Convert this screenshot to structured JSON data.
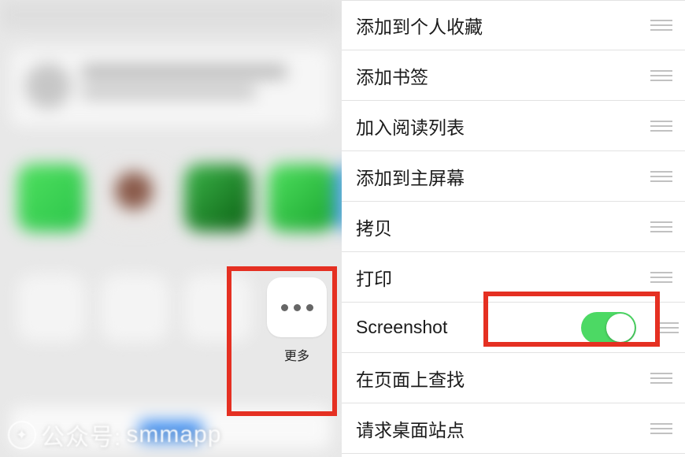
{
  "left": {
    "more_button": {
      "label": "更多"
    },
    "watermark": {
      "prefix": "公众号:",
      "name": "smmapp"
    }
  },
  "right": {
    "items": [
      {
        "label": "添加到个人收藏",
        "interactable": true,
        "has_toggle": false
      },
      {
        "label": "添加书签",
        "interactable": true,
        "has_toggle": false
      },
      {
        "label": "加入阅读列表",
        "interactable": true,
        "has_toggle": false
      },
      {
        "label": "添加到主屏幕",
        "interactable": true,
        "has_toggle": false
      },
      {
        "label": "拷贝",
        "interactable": true,
        "has_toggle": false
      },
      {
        "label": "打印",
        "interactable": true,
        "has_toggle": false
      },
      {
        "label": "Screenshot",
        "interactable": true,
        "has_toggle": true,
        "toggle_on": true
      },
      {
        "label": "在页面上查找",
        "interactable": true,
        "has_toggle": false
      },
      {
        "label": "请求桌面站点",
        "interactable": true,
        "has_toggle": false
      }
    ]
  },
  "highlights": {
    "left_box_target": "more-button",
    "right_box_target": "screenshot-toggle"
  }
}
